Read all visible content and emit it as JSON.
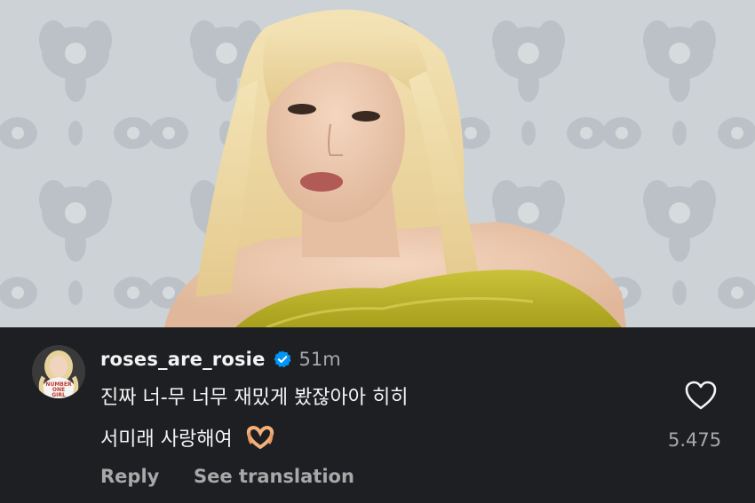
{
  "comment": {
    "username": "roses_are_rosie",
    "verified": true,
    "timestamp": "51m",
    "text_line1": "진짜 너-무 너무 재밌게 봤잖아아 히히",
    "text_line2": "서미래 사랑해여",
    "emoji_icon": "heart-hands-icon",
    "like_count": "5.475",
    "reply_label": "Reply",
    "translate_label": "See translation",
    "avatar_shirt_text": "NUMBER ONE GIRL"
  },
  "colors": {
    "panel_bg": "#1d1f22",
    "primary_text": "#f4f4f4",
    "secondary_text": "#a8a8a8",
    "verified_blue": "#0095f6"
  }
}
